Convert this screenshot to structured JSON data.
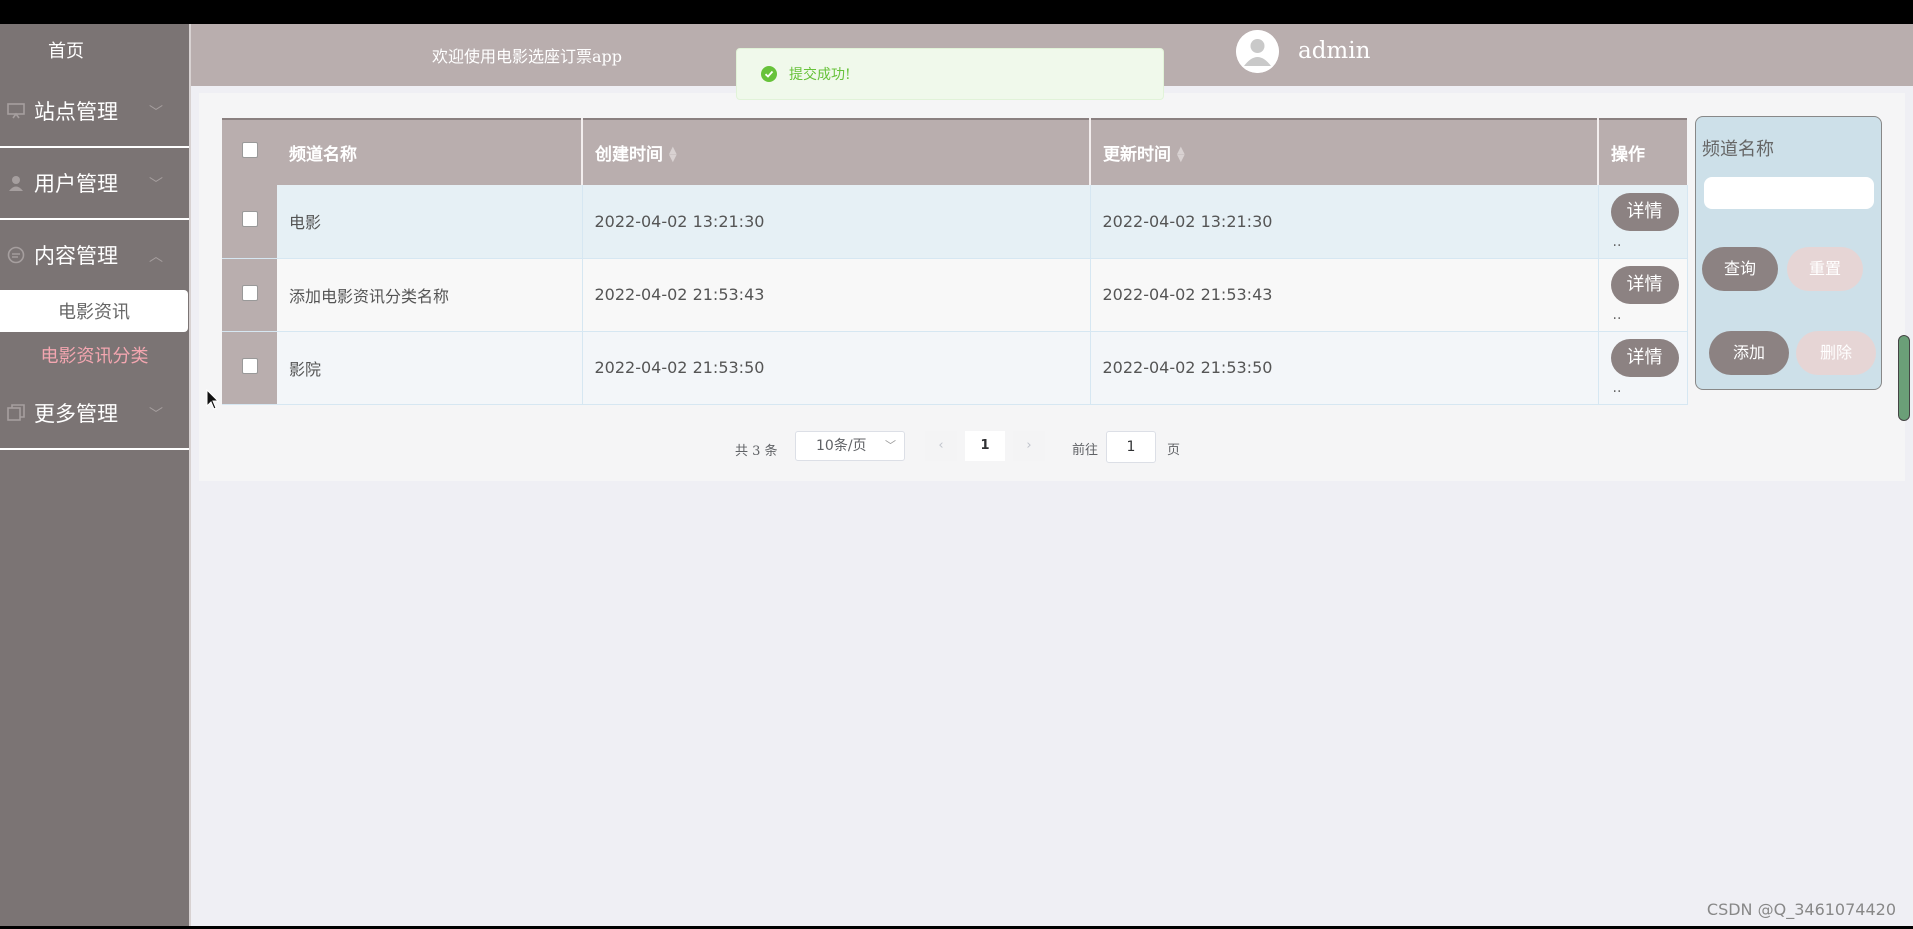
{
  "sidebar": {
    "home": "首页",
    "groups": [
      {
        "label": "站点管理",
        "icon": "monitor-icon"
      },
      {
        "label": "用户管理",
        "icon": "user-icon"
      },
      {
        "label": "内容管理",
        "icon": "chat-icon"
      },
      {
        "label": "更多管理",
        "icon": "copy-icon"
      }
    ],
    "content_sub": [
      "电影资讯",
      "电影资讯分类"
    ]
  },
  "header": {
    "title": "欢迎使用电影选座订票app",
    "user": "admin"
  },
  "toast": {
    "message": "提交成功!",
    "color": "#67c23a"
  },
  "table": {
    "columns": [
      "频道名称",
      "创建时间",
      "更新时间",
      "操作"
    ],
    "rows": [
      {
        "name": "电影",
        "created": "2022-04-02 13:21:30",
        "updated": "2022-04-02 13:21:30"
      },
      {
        "name": "添加电影资讯分类名称",
        "created": "2022-04-02 21:53:43",
        "updated": "2022-04-02 21:53:43"
      },
      {
        "name": "影院",
        "created": "2022-04-02 21:53:50",
        "updated": "2022-04-02 21:53:50"
      }
    ],
    "detail_label": "详情",
    "more": ".."
  },
  "pager": {
    "total": "共 3 条",
    "page_size": "10条/页",
    "current": "1",
    "goto_label": "前往",
    "goto_value": "1",
    "page_unit": "页"
  },
  "search": {
    "label": "频道名称",
    "query": "查询",
    "reset": "重置",
    "add": "添加",
    "delete": "删除"
  },
  "watermark": "CSDN @Q_3461074420",
  "colors": {
    "sidebar": "#7b7474",
    "header": "#b9aeae",
    "button": "#8c8282",
    "active_sub": "#f3a6b0"
  }
}
